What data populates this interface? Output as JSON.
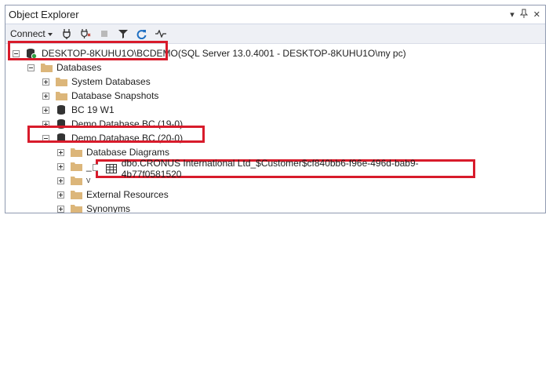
{
  "window": {
    "title": "Object Explorer"
  },
  "title_buttons": {
    "dropdown": "▾",
    "pin": "📌",
    "close": "✕"
  },
  "toolbar": {
    "connect_label": "Connect"
  },
  "tree": {
    "server_label": "DESKTOP-8KUHU1O\\BCDEMO",
    "server_suffix": " (SQL Server 13.0.4001 - DESKTOP-8KUHU1O\\my pc)",
    "databases_label": "Databases",
    "system_databases_label": "System Databases",
    "database_snapshots_label": "Database Snapshots",
    "bc19w1_label": "BC 19 W1",
    "demo19_label": "Demo Database BC (19-0)",
    "demo20_label": "Demo Database BC (20-0)",
    "database_diagrams_label": "Database Diagrams",
    "external_resources_label": "External Resources",
    "synonyms_label": "Synonyms",
    "partial_label": "_",
    "partial_label_2": "V",
    "table_label": "dbo.CRONUS International Ltd_$Customer$cf840bb6-f96e-496d-bab9-4b77f0581520"
  },
  "colors": {
    "highlight": "#d81b2b",
    "folder": "#dcb67a",
    "accent": "#3c8dd0"
  }
}
